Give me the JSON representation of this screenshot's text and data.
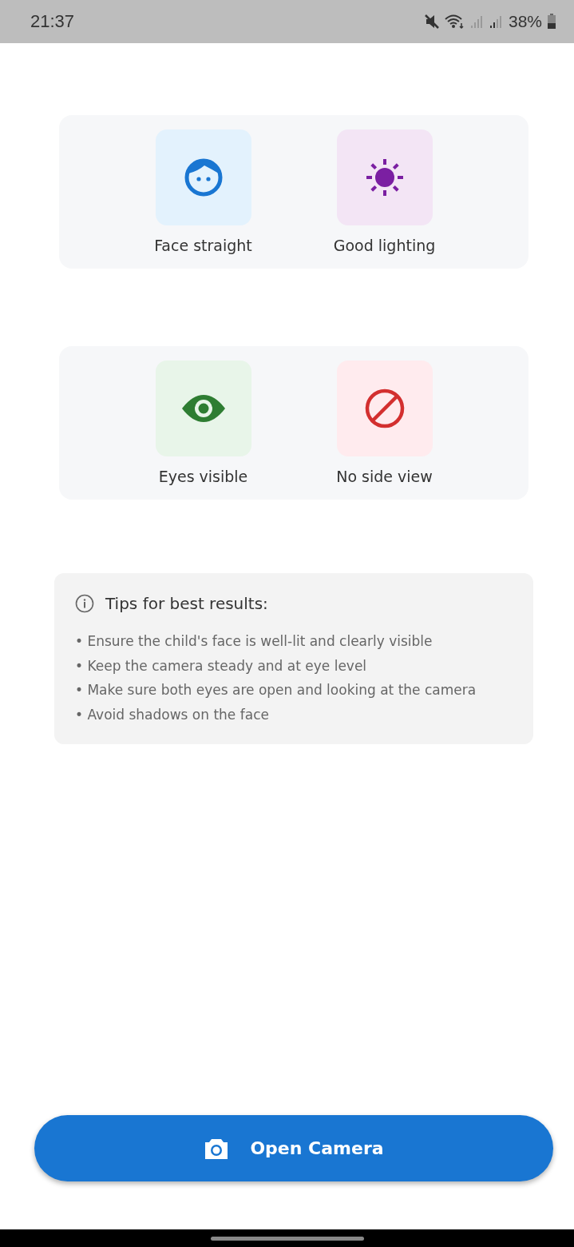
{
  "status_bar": {
    "time": "21:37",
    "battery": "38%"
  },
  "guideline_cards": [
    {
      "items": [
        {
          "kind": "face",
          "label": "Face straight",
          "color": "#1976d2"
        },
        {
          "kind": "sun",
          "label": "Good lighting",
          "color": "#7b1fa2"
        }
      ]
    },
    {
      "items": [
        {
          "kind": "eye",
          "label": "Eyes visible",
          "color": "#2e7d32"
        },
        {
          "kind": "block",
          "label": "No side view",
          "color": "#d32f2f"
        }
      ]
    }
  ],
  "tips": {
    "title": "Tips for best results:",
    "items": [
      "• Ensure the child's face is well-lit and clearly visible",
      "• Keep the camera steady and at eye level",
      "• Make sure both eyes are open and looking at the camera",
      "• Avoid shadows on the face"
    ]
  },
  "primary_button": {
    "label": "Open Camera"
  }
}
